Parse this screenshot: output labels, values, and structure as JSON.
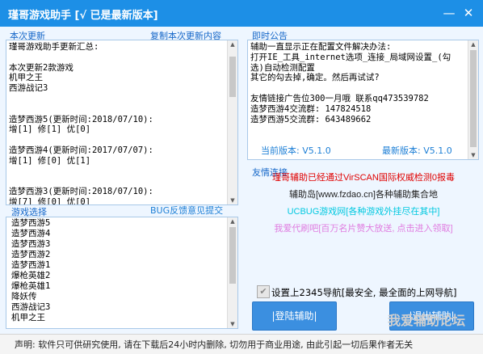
{
  "window": {
    "title": "瑾哥游戏助手 [√ 已是最新版本]"
  },
  "labels": {
    "update": "本次更新",
    "copy_update": "复制本次更新内容",
    "notice": "即时公告",
    "friend_links": "友情连接",
    "game_select": "游戏选择",
    "bug_feedback": "BUG反馈意见提交"
  },
  "update_text": [
    "瑾哥游戏助手更新汇总:",
    "",
    "本次更新2款游戏",
    "机甲之王",
    "西游战记3",
    "",
    "",
    "造梦西游5(更新时间:2018/07/10):",
    "增[1] 修[1] 优[0]",
    "",
    "造梦西游4(更新时间:2017/07/07):",
    "增[1] 修[0] 优[1]",
    "",
    "",
    "造梦西游3(更新时间:2018/07/10):",
    "增[7] 修[0] 优[0]"
  ],
  "notice_text": [
    "辅助一直显示正在配置文件解决办法:",
    "打开IE_工具_internet选项_连接_局域网设置_(勾",
    "选)自动检测配置",
    "其它的勾去掉,确定。然后再试试?",
    "",
    "友情链接广告位300一月哦 联系qq473539782",
    "造梦西游4交流群: 147824518",
    "造梦西游5交流群: 643489662"
  ],
  "version": {
    "current": "当前版本: V5.1.0",
    "latest": "最新版本: V5.1.0"
  },
  "links": [
    {
      "text": "瑾哥辅助已经通过VirSCAN国际权威检测0报毒",
      "color": "#e00000"
    },
    {
      "text": "辅助岛[www.fzdao.cn]各种辅助集合地",
      "color": "#222222"
    },
    {
      "text": "UCBUG游戏网[各种游戏外挂尽在其中]",
      "color": "#00c8e0"
    },
    {
      "text": "我爱代刷吧[百万名片赞大放送, 点击进入领取]",
      "color": "#e07ce0"
    }
  ],
  "games": [
    "造梦西游5",
    "造梦西游4",
    "造梦西游3",
    "造梦西游2",
    "造梦西游1",
    "爆枪英雄2",
    "爆枪英雄1",
    "降妖传",
    "西游战记3",
    "机甲之王"
  ],
  "checkbox": {
    "label": "设置上2345导航[最安全, 最全面的上网导航]",
    "checked": true
  },
  "buttons": {
    "login": "|登陆辅助|",
    "exit": "|退出辅助|"
  },
  "footer": "声明: 软件只可供研究使用, 请在下载后24小时内删除, 切勿用于商业用途, 由此引起一切后果作者无关",
  "watermark": "我爱辅助论坛"
}
